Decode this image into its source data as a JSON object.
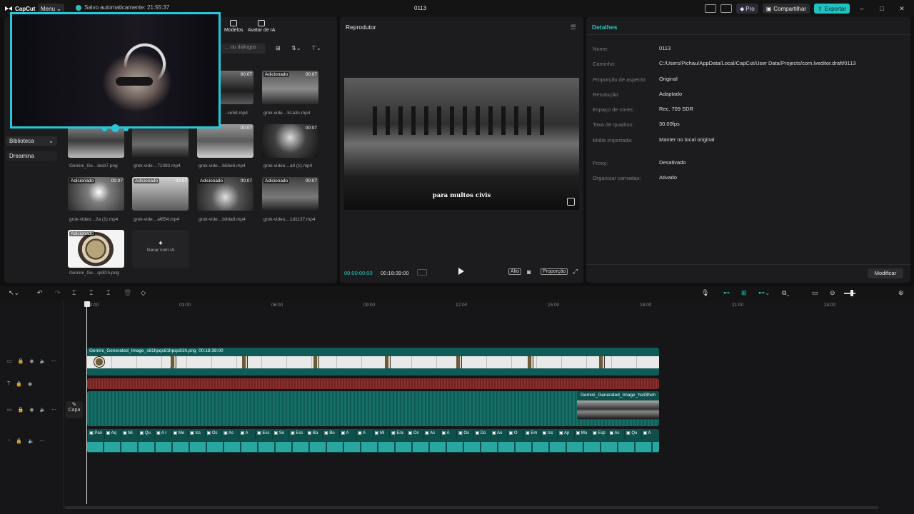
{
  "app": {
    "logo": "CapCut",
    "menu": "Menu",
    "autosave": "Salvo automaticamente: 21:55:37",
    "window_title": "0113"
  },
  "titlebar": {
    "pro": "Pro",
    "share": "Compartilhar",
    "export": "Exportar",
    "minimize": "–",
    "maximize": "□",
    "close": "✕"
  },
  "media": {
    "tabs": [
      {
        "label": "Modelos"
      },
      {
        "label": "Avatar de IA"
      }
    ],
    "search_placeholder": "… ou diálogos",
    "nav": [
      {
        "label": "Biblioteca"
      },
      {
        "label": "Dreamina"
      }
    ],
    "items": [
      {
        "name": "…ce58.mp4",
        "badge": "",
        "dur": "00:07"
      },
      {
        "name": "grok-vide…51a3c.mp4",
        "badge": "Adicionado",
        "dur": "00:07"
      },
      {
        "name": "Gemini_Ge…bisb7.png",
        "badge": "",
        "dur": ""
      },
      {
        "name": "grok-vide…71082.mp4",
        "badge": "",
        "dur": ""
      },
      {
        "name": "grok-vide…b5be6.mp4",
        "badge": "",
        "dur": "00:07"
      },
      {
        "name": "grok-video…a9 (1).mp4",
        "badge": "",
        "dur": "00:07"
      },
      {
        "name": "grok-video…2a (1).mp4",
        "badge": "Adicionado",
        "dur": "00:07"
      },
      {
        "name": "grok-vide…af854.mp4",
        "badge": "Adicionado",
        "dur": "00:07"
      },
      {
        "name": "grok-vide…b9da9.mp4",
        "badge": "Adicionado",
        "dur": "00:07"
      },
      {
        "name": "grok-video…1d1137.mp4",
        "badge": "Adicionado",
        "dur": "00:07"
      },
      {
        "name": "Gemini_Ge…qs81h.png",
        "badge": "Adicionado",
        "dur": ""
      }
    ],
    "gen_ai": "Gerar com IA"
  },
  "player": {
    "title": "Reprodutor",
    "subtitle": "para multos civis",
    "time_current": "00:00:00:00",
    "time_total": "00:18:39:00",
    "quality": "Alto",
    "ratio": "Proporção"
  },
  "details": {
    "title": "Detalhes",
    "rows": [
      {
        "label": "Nome:",
        "value": "0113"
      },
      {
        "label": "Caminho:",
        "value": "C:/Users/Pichau/AppData/Local/CapCut/User Data/Projects/com.lveditor.draft/0113"
      },
      {
        "label": "Proporção de aspecto:",
        "value": "Original"
      },
      {
        "label": "Resolução:",
        "value": "Adaptado"
      },
      {
        "label": "Espaço de cores:",
        "value": "Rec. 709 SDR"
      },
      {
        "label": "Taxa de quadros:",
        "value": "30.00fps"
      },
      {
        "label": "Mídia importada:",
        "value": "Manter no local original"
      },
      {
        "label": "Proxy:",
        "value": "Desativado"
      },
      {
        "label": "Organizar camadas:",
        "value": "Ativado"
      }
    ],
    "modify": "Modificar"
  },
  "timeline": {
    "ruler": [
      "00:00",
      "03:00",
      "06:00",
      "09:00",
      "12:00",
      "15:00",
      "18:00",
      "21:00",
      "24:00"
    ],
    "clip_main": {
      "name": "Gemini_Generated_Image_s81hpqs81hpqs81h.png",
      "duration": "00:18:39:00"
    },
    "clip_end": "Gemini_Generated_Image_hsd3heh",
    "cover": "Capa",
    "audio_words": [
      "Pan",
      "Aq",
      "Mi",
      "Qu",
      "A r",
      "Me",
      "Iss",
      "Os",
      "As",
      "A",
      "Ess",
      "So",
      "Ess",
      "Ba",
      "Bo",
      "A",
      "A",
      "Mi",
      "Era",
      "Os",
      "As",
      "A",
      "Os",
      "Do",
      "Ao",
      "O",
      "Em",
      "Iss",
      "Ap",
      "Mu",
      "Esp",
      "As",
      "Qu",
      "A"
    ]
  }
}
